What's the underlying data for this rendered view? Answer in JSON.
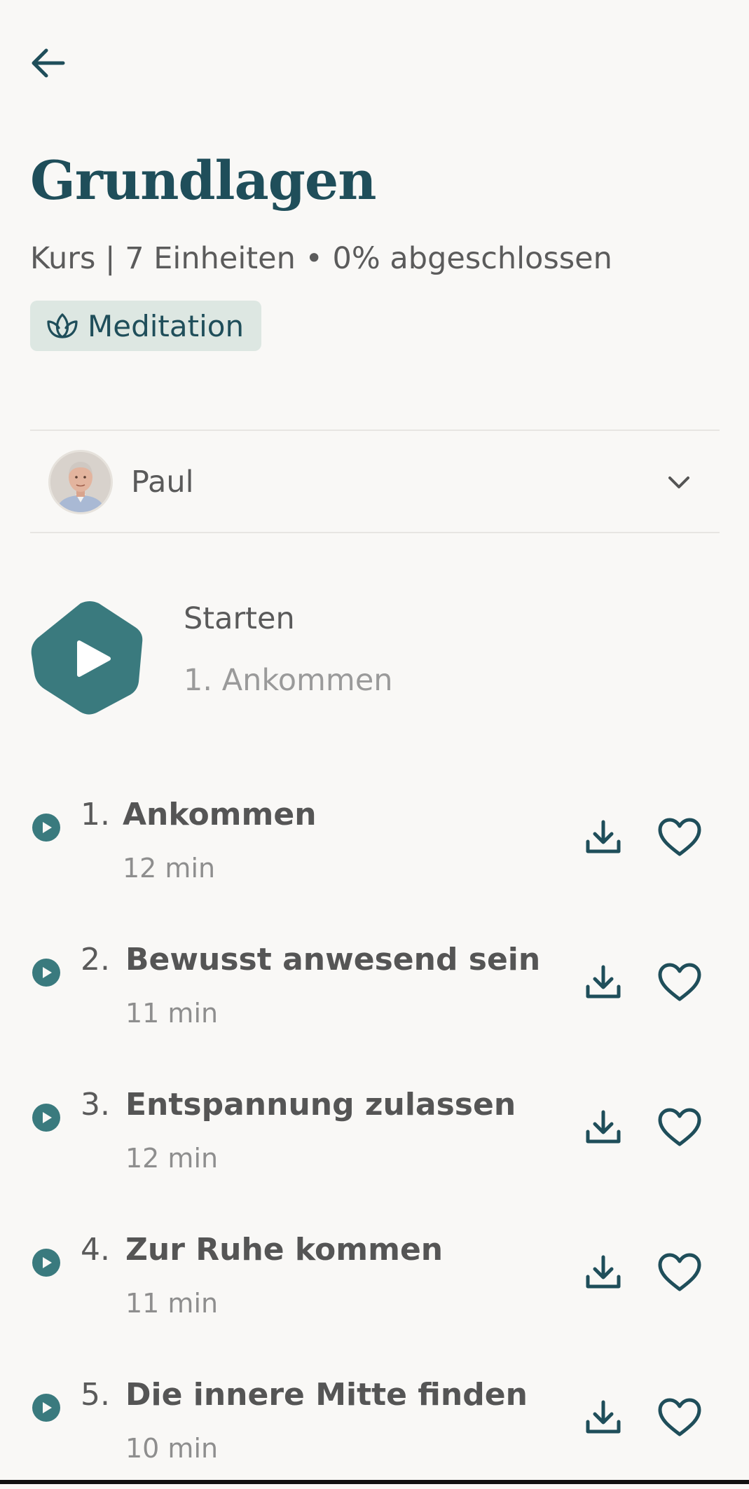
{
  "header": {
    "back_icon": "arrow-left-icon",
    "title": "Grundlagen",
    "subtitle": "Kurs | 7 Einheiten • 0% abgeschlossen",
    "tag": {
      "icon": "lotus-icon",
      "label": "Meditation"
    }
  },
  "narrator": {
    "name": "Paul",
    "icon": "chevron-down-icon"
  },
  "start": {
    "label": "Starten",
    "sub": "1. Ankommen"
  },
  "colors": {
    "accent": "#3a7a7e",
    "title": "#1f4e5a",
    "tag_bg": "#dde7e2",
    "background": "#f9f8f6"
  },
  "sessions": [
    {
      "num": "1.",
      "title": "Ankommen",
      "duration": "12 min"
    },
    {
      "num": "2.",
      "title": "Bewusst anwesend sein",
      "duration": "11 min"
    },
    {
      "num": "3.",
      "title": "Entspannung zulassen",
      "duration": "12 min"
    },
    {
      "num": "4.",
      "title": "Zur Ruhe kommen",
      "duration": "11 min"
    },
    {
      "num": "5.",
      "title": "Die innere Mitte finden",
      "duration": "10 min"
    }
  ]
}
